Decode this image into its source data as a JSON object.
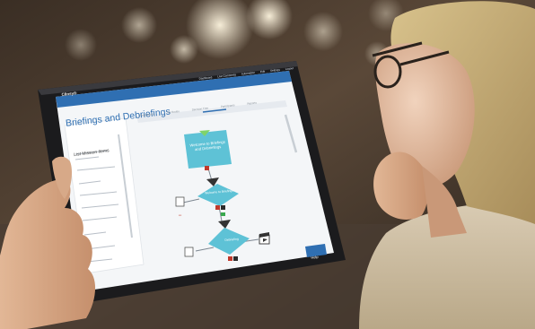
{
  "app": {
    "logo": "Clinsy®",
    "nav": [
      "Dashboard",
      "Live Comments",
      "Automation",
      "Edit",
      "Settings",
      "Logout"
    ]
  },
  "page": {
    "title": "Briefings and Debriefings",
    "subtitle": ""
  },
  "tabs": [
    "Preferences",
    "The Nodes",
    "Decision Tree",
    "Participants",
    "Reports"
  ],
  "sidebar": {
    "heading": "List Mission Items",
    "items": [
      "",
      "",
      "",
      "",
      "",
      "",
      "",
      "",
      "",
      ""
    ]
  },
  "flow": {
    "start_node": "Welcome to Briefings and Debriefings",
    "decision_1": "Welcome to Briefings",
    "decision_2": "Debriefing"
  },
  "help_button": "Help",
  "colors": {
    "header_blue": "#2f6fb2",
    "node_teal": "#5ec2d6",
    "arrow_dark": "#333333",
    "help_blue": "#2f6fb2"
  }
}
